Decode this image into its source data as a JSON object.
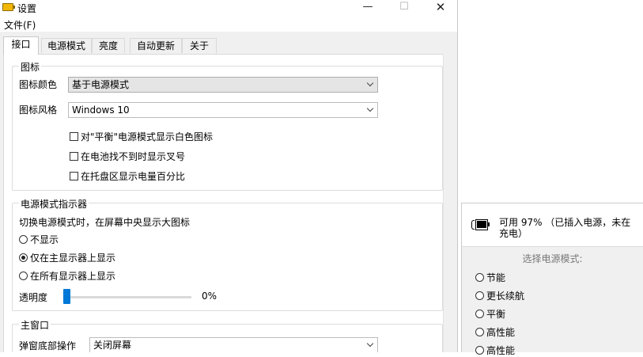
{
  "window": {
    "title": "设置",
    "min_symbol": "—",
    "max_symbol": "☐",
    "close_symbol": "✕"
  },
  "menu": {
    "file": "文件(F)"
  },
  "tabs": [
    {
      "label": "接口",
      "active": true
    },
    {
      "label": "电源模式"
    },
    {
      "label": "亮度"
    },
    {
      "label": "自动更新"
    },
    {
      "label": "关于"
    }
  ],
  "icon_group": {
    "legend": "图标",
    "color_label": "图标颜色",
    "color_value": "基于电源模式",
    "style_label": "图标风格",
    "style_value": "Windows 10",
    "checkboxes": [
      "对\"平衡\"电源模式显示白色图标",
      "在电池找不到时显示叉号",
      "在托盘区显示电量百分比"
    ]
  },
  "indicator_group": {
    "legend": "电源模式指示器",
    "description": "切换电源模式时，在屏幕中央显示大图标",
    "options": [
      {
        "label": "不显示",
        "selected": false
      },
      {
        "label": "仅在主显示器上显示",
        "selected": true
      },
      {
        "label": "在所有显示器上显示",
        "selected": false
      }
    ],
    "opacity_label": "透明度",
    "opacity_value": "0%"
  },
  "main_window_group": {
    "legend": "主窗口",
    "action_label": "弹窗底部操作",
    "action_value": "关闭屏幕"
  },
  "flyout": {
    "status_line1": "可用 97% （已插入电源，未在",
    "status_line2": "充电）",
    "select_label": "选择电源模式:",
    "modes": [
      "节能",
      "更长续航",
      "平衡",
      "高性能",
      "高性能"
    ]
  },
  "colors": {
    "accent": "#0078d7",
    "battery_icon": "#f2b705"
  }
}
